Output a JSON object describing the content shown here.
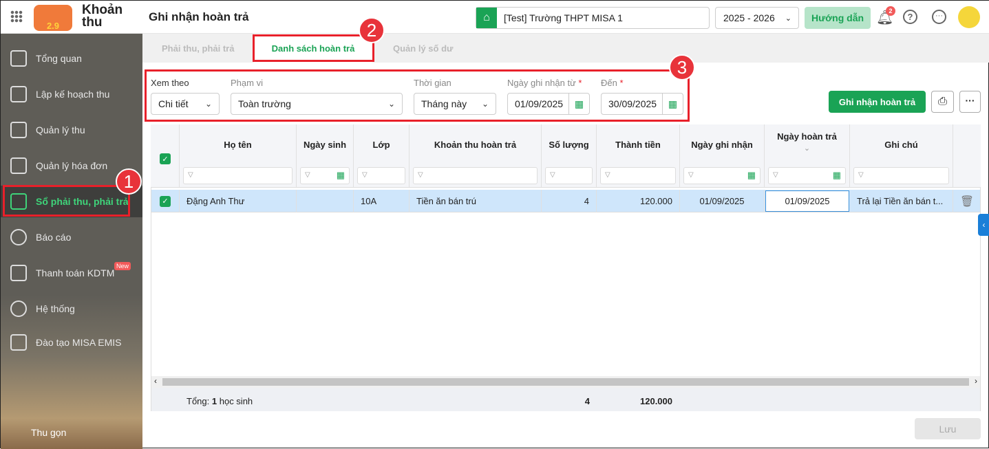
{
  "header": {
    "app_name_line1": "Khoản",
    "app_name_line2": "thu",
    "logo_text": "2.9",
    "page_title": "Ghi nhận hoàn trả",
    "school": "[Test] Trường THPT MISA 1",
    "year": "2025 - 2026",
    "guide_button": "Hướng dẫn",
    "notification_count": "2"
  },
  "sidebar": {
    "items": [
      {
        "label": "Tổng quan"
      },
      {
        "label": "Lập kế hoạch thu"
      },
      {
        "label": "Quản lý thu"
      },
      {
        "label": "Quản lý hóa đơn"
      },
      {
        "label": "Sổ phải thu, phải trả"
      },
      {
        "label": "Báo cáo"
      },
      {
        "label": "Thanh toán KDTM",
        "badge": "New"
      },
      {
        "label": "Hệ thống"
      },
      {
        "label": "Đào tạo MISA EMIS"
      }
    ],
    "collapse": "Thu gọn"
  },
  "tabs": [
    {
      "label": "Phải thu, phải trả"
    },
    {
      "label": "Danh sách hoàn trả"
    },
    {
      "label": "Quản lý số dư"
    }
  ],
  "annotations": [
    "1",
    "2",
    "3"
  ],
  "filters": {
    "view_label": "Xem theo",
    "view_value": "Chi tiết",
    "scope_label": "Phạm vi",
    "scope_value": "Toàn trường",
    "time_label": "Thời gian",
    "time_value": "Tháng này",
    "from_label": "Ngày ghi nhận từ",
    "from_value": "01/09/2025",
    "to_label": "Đến",
    "to_value": "30/09/2025",
    "required": "*"
  },
  "actions": {
    "record_button": "Ghi nhận hoàn trả",
    "save_button": "Lưu"
  },
  "table": {
    "columns": [
      "Họ tên",
      "Ngày sinh",
      "Lớp",
      "Khoản thu hoàn trả",
      "Số lượng",
      "Thành tiền",
      "Ngày ghi nhận",
      "Ngày hoàn trả",
      "Ghi chú"
    ],
    "rows": [
      {
        "name": "Đặng Anh Thư",
        "dob": "",
        "class": "10A",
        "item": "Tiền ăn bán trú",
        "qty": "4",
        "amount": "120.000",
        "record_date": "01/09/2025",
        "refund_date": "01/09/2025",
        "note": "Trả lại Tiền ăn bán t..."
      }
    ],
    "footer": {
      "total_label": "Tổng:",
      "total_count": "1",
      "total_unit": "học sinh",
      "qty": "4",
      "amount": "120.000"
    }
  },
  "colors": {
    "accent": "#1aa355",
    "annotation": "#e8202a",
    "selected_row": "#cfe6fb"
  }
}
